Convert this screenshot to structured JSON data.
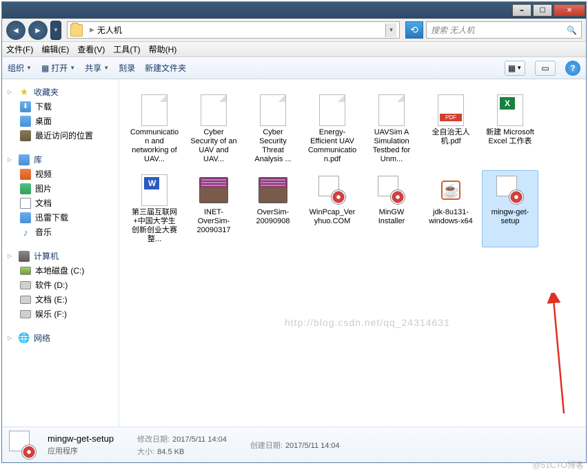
{
  "titlebar": {},
  "nav": {
    "folder_name": "无人机",
    "search_placeholder": "搜索 无人机"
  },
  "menu": {
    "file": "文件(F)",
    "edit": "编辑(E)",
    "view": "查看(V)",
    "tools": "工具(T)",
    "help": "帮助(H)"
  },
  "toolbar": {
    "organize": "组织",
    "open": "打开",
    "share": "共享",
    "burn": "刻录",
    "new_folder": "新建文件夹"
  },
  "sidebar": {
    "favorites": {
      "label": "收藏夹",
      "items": [
        "下载",
        "桌面",
        "最近访问的位置"
      ]
    },
    "libraries": {
      "label": "库",
      "items": [
        "视频",
        "图片",
        "文档",
        "迅雷下载",
        "音乐"
      ]
    },
    "computer": {
      "label": "计算机",
      "items": [
        "本地磁盘 (C:)",
        "软件 (D:)",
        "文档 (E:)",
        "娱乐 (F:)"
      ]
    },
    "network": {
      "label": "网络"
    }
  },
  "files": [
    {
      "name": "Communication and networking of UAV...",
      "type": "doc"
    },
    {
      "name": "Cyber Security of an UAV and UAV...",
      "type": "doc"
    },
    {
      "name": "Cyber Security Threat Analysis ...",
      "type": "doc"
    },
    {
      "name": "Energy-Efficient UAV Communication.pdf",
      "type": "doc"
    },
    {
      "name": "UAVSim A Simulation Testbed for Unm...",
      "type": "doc"
    },
    {
      "name": "全自治无人机.pdf",
      "type": "pdf"
    },
    {
      "name": "新建 Microsoft Excel 工作表",
      "type": "excel"
    },
    {
      "name": "第三届互联网+中国大学生创新创业大赛整...",
      "type": "word"
    },
    {
      "name": "INET-OverSim-20090317",
      "type": "rar"
    },
    {
      "name": "OverSim-20090908",
      "type": "rar"
    },
    {
      "name": "WinPcap_Veryhuo.COM",
      "type": "exe"
    },
    {
      "name": "MinGW Installer",
      "type": "exe"
    },
    {
      "name": "jdk-8u131-windows-x64",
      "type": "java"
    },
    {
      "name": "mingw-get-setup",
      "type": "exe",
      "selected": true
    }
  ],
  "details": {
    "name": "mingw-get-setup",
    "type": "应用程序",
    "modified_label": "修改日期:",
    "modified": "2017/5/11 14:04",
    "size_label": "大小:",
    "size": "84.5 KB",
    "created_label": "创建日期:",
    "created": "2017/5/11 14:04"
  },
  "watermark": "http://blog.csdn.net/qq_24314631",
  "corner_watermark": "@51CTO博客"
}
